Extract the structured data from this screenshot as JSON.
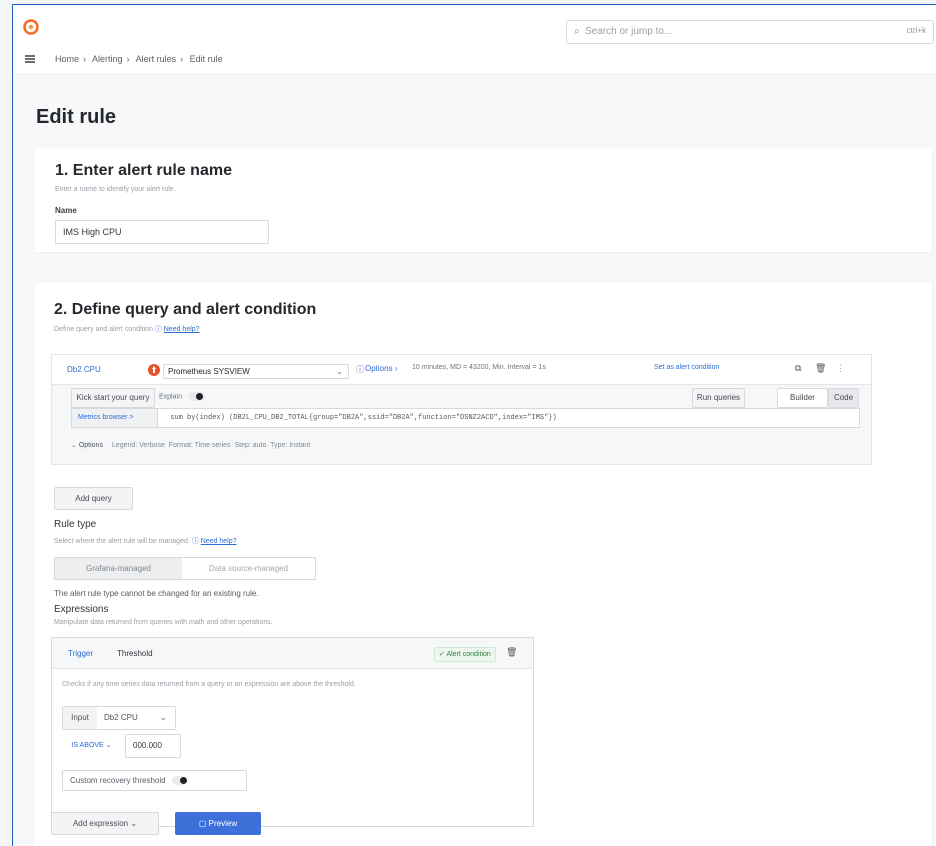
{
  "header": {
    "search_placeholder": "Search or jump to...",
    "search_shortcut": "ctrl+k",
    "breadcrumb": [
      "Home",
      "Alerting",
      "Alert rules",
      "Edit rule"
    ]
  },
  "page": {
    "title": "Edit rule"
  },
  "step1": {
    "heading": "1. Enter alert rule name",
    "description": "Enter a name to identify your alert rule.",
    "name_label": "Name",
    "name_value": "IMS High CPU"
  },
  "step2": {
    "heading": "2. Define query and alert condition",
    "description": "Define query and alert condition",
    "need_help": "Need help?",
    "query": {
      "ref_id": "Db2 CPU",
      "datasource": "Prometheus SYSVIEW",
      "options_label": "Options",
      "options_summary": "10 minutes, MD = 43200, Min. Interval = 1s",
      "set_alert_condition": "Set as alert condition",
      "kick_start": "Kick start your query",
      "explain_label": "Explain",
      "run_queries": "Run queries",
      "builder_label": "Builder",
      "code_label": "Code",
      "metrics_browser": "Metrics browser >",
      "promql": "sum by(index) (DB2L_CPU_DB2_TOTAL{group=\"DB2A\",ssid=\"DB2A\",function=\"DSNZ2ACD\",index=\"IMS\"})",
      "options_row": [
        "Options",
        "Legend: Verbose",
        "Format: Time series",
        "Step: auto",
        "Type: Instant"
      ]
    },
    "add_query": "Add query",
    "rule_type": {
      "heading": "Rule type",
      "description": "Select where the alert rule will be managed.",
      "need_help": "Need help?",
      "options": [
        "Grafana-managed",
        "Data source-managed"
      ],
      "note": "The alert rule type cannot be changed for an existing rule."
    },
    "expressions": {
      "heading": "Expressions",
      "description": "Manipulate data returned from queries with math and other operations.",
      "tabs": [
        "Trigger",
        "Threshold"
      ],
      "alert_condition": "Alert condition",
      "threshold_description": "Checks if any time series data returned from a query or an expression are above the threshold.",
      "input_label": "Input",
      "input_value": "Db2 CPU",
      "operator": "IS ABOVE",
      "threshold_value": "000.000",
      "custom_recovery": "Custom recovery threshold"
    },
    "add_expression": "Add expression",
    "preview": "Preview"
  }
}
